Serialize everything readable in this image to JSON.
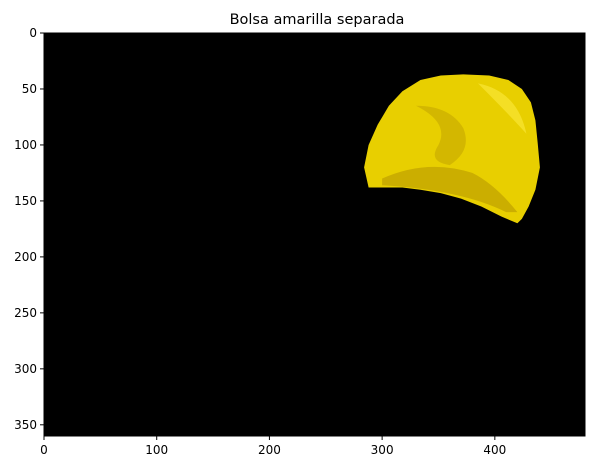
{
  "chart_data": {
    "type": "image",
    "title": "Bolsa amarilla separada",
    "xlabel": "",
    "ylabel": "",
    "image_size": {
      "width": 480,
      "height": 360
    },
    "xlim": [
      0,
      480
    ],
    "ylim": [
      360,
      0
    ],
    "y_inverted": true,
    "x_ticks": [
      0,
      100,
      200,
      300,
      400
    ],
    "y_ticks": [
      0,
      50,
      100,
      150,
      200,
      250,
      300,
      350
    ],
    "grid": false,
    "background_color": "#000000",
    "content": {
      "object": "yellow-bag",
      "color": "#e8cf00",
      "highlight_color": "#fff04a",
      "shadow_color": "#b39400",
      "outline_points": [
        [
          288,
          138
        ],
        [
          284,
          120
        ],
        [
          288,
          100
        ],
        [
          296,
          82
        ],
        [
          306,
          65
        ],
        [
          318,
          52
        ],
        [
          334,
          42
        ],
        [
          352,
          38
        ],
        [
          372,
          37
        ],
        [
          395,
          38
        ],
        [
          412,
          42
        ],
        [
          424,
          50
        ],
        [
          432,
          62
        ],
        [
          436,
          78
        ],
        [
          438,
          98
        ],
        [
          440,
          120
        ],
        [
          436,
          140
        ],
        [
          430,
          155
        ],
        [
          424,
          166
        ],
        [
          420,
          170
        ],
        [
          406,
          164
        ],
        [
          388,
          155
        ],
        [
          370,
          148
        ],
        [
          352,
          143
        ],
        [
          334,
          140
        ],
        [
          318,
          138
        ],
        [
          302,
          138
        ]
      ]
    }
  }
}
